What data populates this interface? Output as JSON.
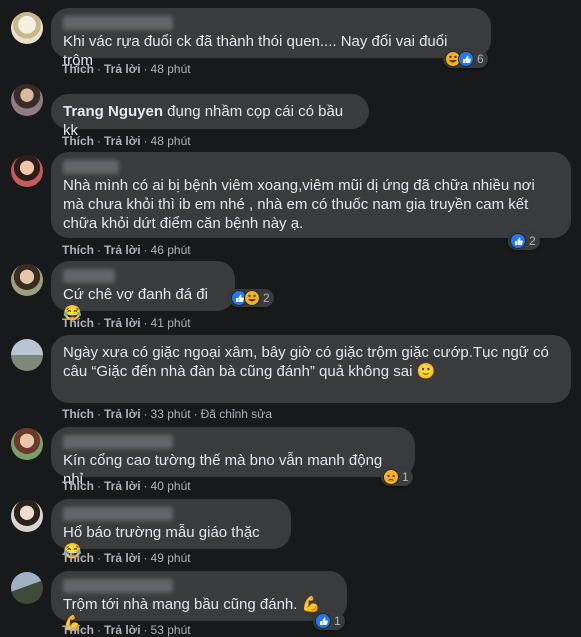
{
  "comments": [
    {
      "author": "",
      "author_blurred": true,
      "text": "Khi vác rựa đuổi ck đã thành thói quen.... Nay đổi vai đuổi trộm",
      "like": "Thích",
      "reply": "Trả lời",
      "time": "48 phút",
      "reactions": [
        "haha",
        "like"
      ],
      "count": "6"
    },
    {
      "author": "Trang Nguyen",
      "author_blurred": false,
      "text": " đụng nhầm cọp cái có bầu kk",
      "like": "Thích",
      "reply": "Trả lời",
      "time": "48 phút",
      "reactions": [],
      "count": ""
    },
    {
      "author": "",
      "author_blurred": true,
      "text": "Nhà mình có ai bị bệnh viêm xoang,viêm mũi dị ứng đã chữa nhiều nơi mà chưa khỏi thì ib em nhé , nhà em có thuốc nam gia truyền cam kết chữa khỏi dứt điểm căn bệnh này ạ.",
      "like": "Thích",
      "reply": "Trả lời",
      "time": "46 phút",
      "reactions": [
        "like"
      ],
      "count": "2"
    },
    {
      "author": "",
      "author_blurred": true,
      "text": "Cứ chê vợ đanh đá đi 😂",
      "like": "Thích",
      "reply": "Trả lời",
      "time": "41 phút",
      "reactions": [
        "like",
        "haha"
      ],
      "count": "2"
    },
    {
      "author": "",
      "author_blurred": true,
      "text": "Ngày xưa có giặc ngoại xâm, bây giờ có giặc trộm giặc cướp.Tục ngữ có câu “Giặc đến nhà đàn bà cũng đánh” quả không sai 🙂",
      "like": "Thích",
      "reply": "Trả lời",
      "time": "33 phút",
      "edited": "Đã chỉnh sửa",
      "reactions": [],
      "count": ""
    },
    {
      "author": "",
      "author_blurred": true,
      "text": "Kín cổng cao tường thế mà bno vẫn manh động nhỉ",
      "like": "Thích",
      "reply": "Trả lời",
      "time": "40 phút",
      "reactions": [
        "sad"
      ],
      "count": "1"
    },
    {
      "author": "",
      "author_blurred": true,
      "text": "Hổ báo trường mẫu giáo thặc 😂",
      "like": "Thích",
      "reply": "Trả lời",
      "time": "49 phút",
      "reactions": [],
      "count": ""
    },
    {
      "author": "",
      "author_blurred": true,
      "text": "Trộm tới nhà mang bầu cũng đánh. 💪💪",
      "like": "Thích",
      "reply": "Trả lời",
      "time": "53 phút",
      "reactions": [
        "like"
      ],
      "count": "1"
    }
  ],
  "colors": {
    "background": "#18191a",
    "bubble": "#3a3b3c",
    "text": "#e4e6eb",
    "meta": "#b0b3b8",
    "like": "#2078f4",
    "haha": "#f7b125"
  }
}
